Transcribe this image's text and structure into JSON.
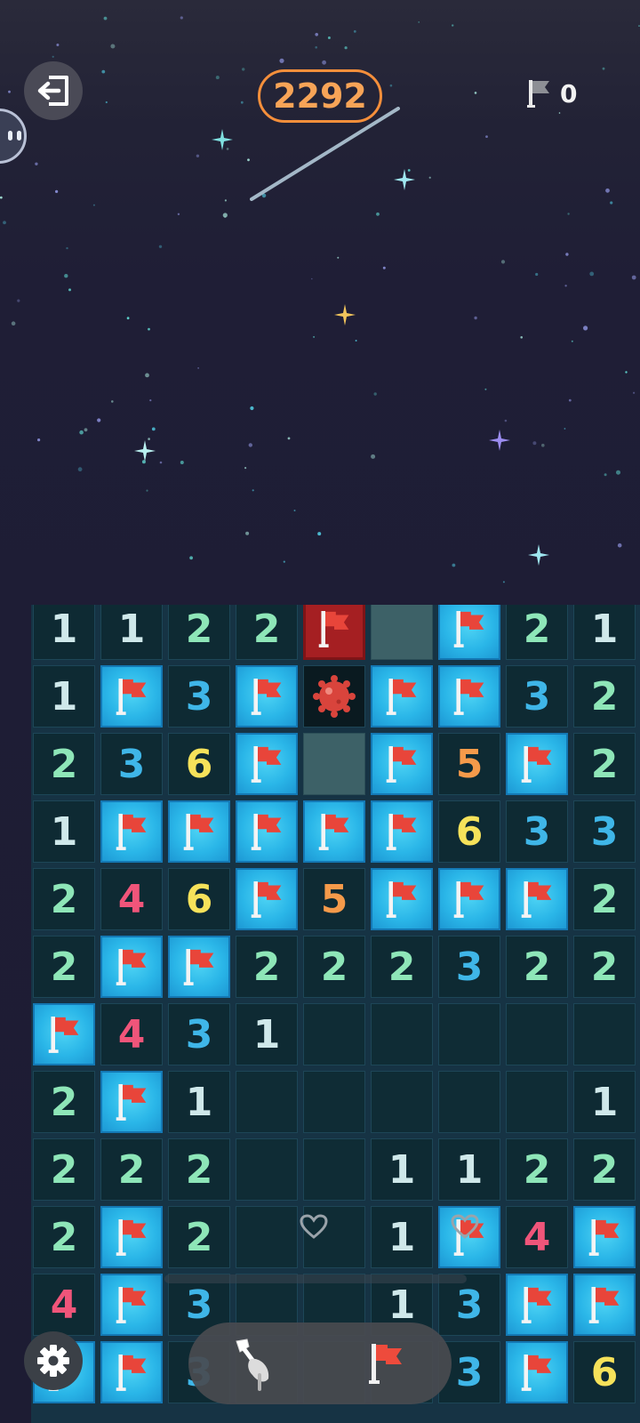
{
  "header": {
    "score": "2292",
    "flags_placed": "0"
  },
  "icons": {
    "exit": "exit-door-icon",
    "flag": "red-flag-icon",
    "shovel": "shovel-icon",
    "settings": "gear-icon",
    "mine": "mine-icon",
    "heart": "heart-icon"
  },
  "colors": {
    "score_accent": "#f58f3b",
    "flag_tile": "#2ab6e8",
    "number_1": "#cfe8ea",
    "number_2": "#8ee6b8",
    "number_3": "#3fb6e8",
    "number_4": "#f0557a",
    "number_5": "#f59a4a",
    "number_6": "#f6e25a"
  },
  "board": {
    "columns": 9,
    "legend": "N = number, F = flag, P = covered, X = flagged wrong, M = mine, . = empty",
    "rows": [
      [
        "1",
        "1",
        "2",
        "2",
        "X",
        "P",
        "F",
        "2",
        "1"
      ],
      [
        "1",
        "F",
        "3",
        "F",
        "M",
        "F",
        "F",
        "3",
        "2"
      ],
      [
        "2",
        "3",
        "6",
        "F",
        "P",
        "F",
        "5",
        "F",
        "2"
      ],
      [
        "1",
        "F",
        "F",
        "F",
        "F",
        "F",
        "6",
        "3",
        "3"
      ],
      [
        "2",
        "4",
        "6",
        "F",
        "5",
        "F",
        "F",
        "F",
        "2"
      ],
      [
        "2",
        "F",
        "F",
        "2",
        "2",
        "2",
        "3",
        "2",
        "2"
      ],
      [
        "F",
        "4",
        "3",
        "1",
        ".",
        ".",
        ".",
        ".",
        "."
      ],
      [
        "2",
        "F",
        "1",
        ".",
        ".",
        ".",
        ".",
        ".",
        "1"
      ],
      [
        "2",
        "2",
        "2",
        ".",
        ".",
        "1",
        "1",
        "2",
        "2"
      ],
      [
        "2",
        "F",
        "2",
        ".",
        ".",
        "1",
        "F",
        "4",
        "F"
      ],
      [
        "4",
        "F",
        "3",
        ".",
        ".",
        "1",
        "3",
        "F",
        "F"
      ],
      [
        "F",
        "F",
        "3",
        ".",
        ".",
        ".",
        "3",
        "F",
        "6"
      ]
    ]
  }
}
